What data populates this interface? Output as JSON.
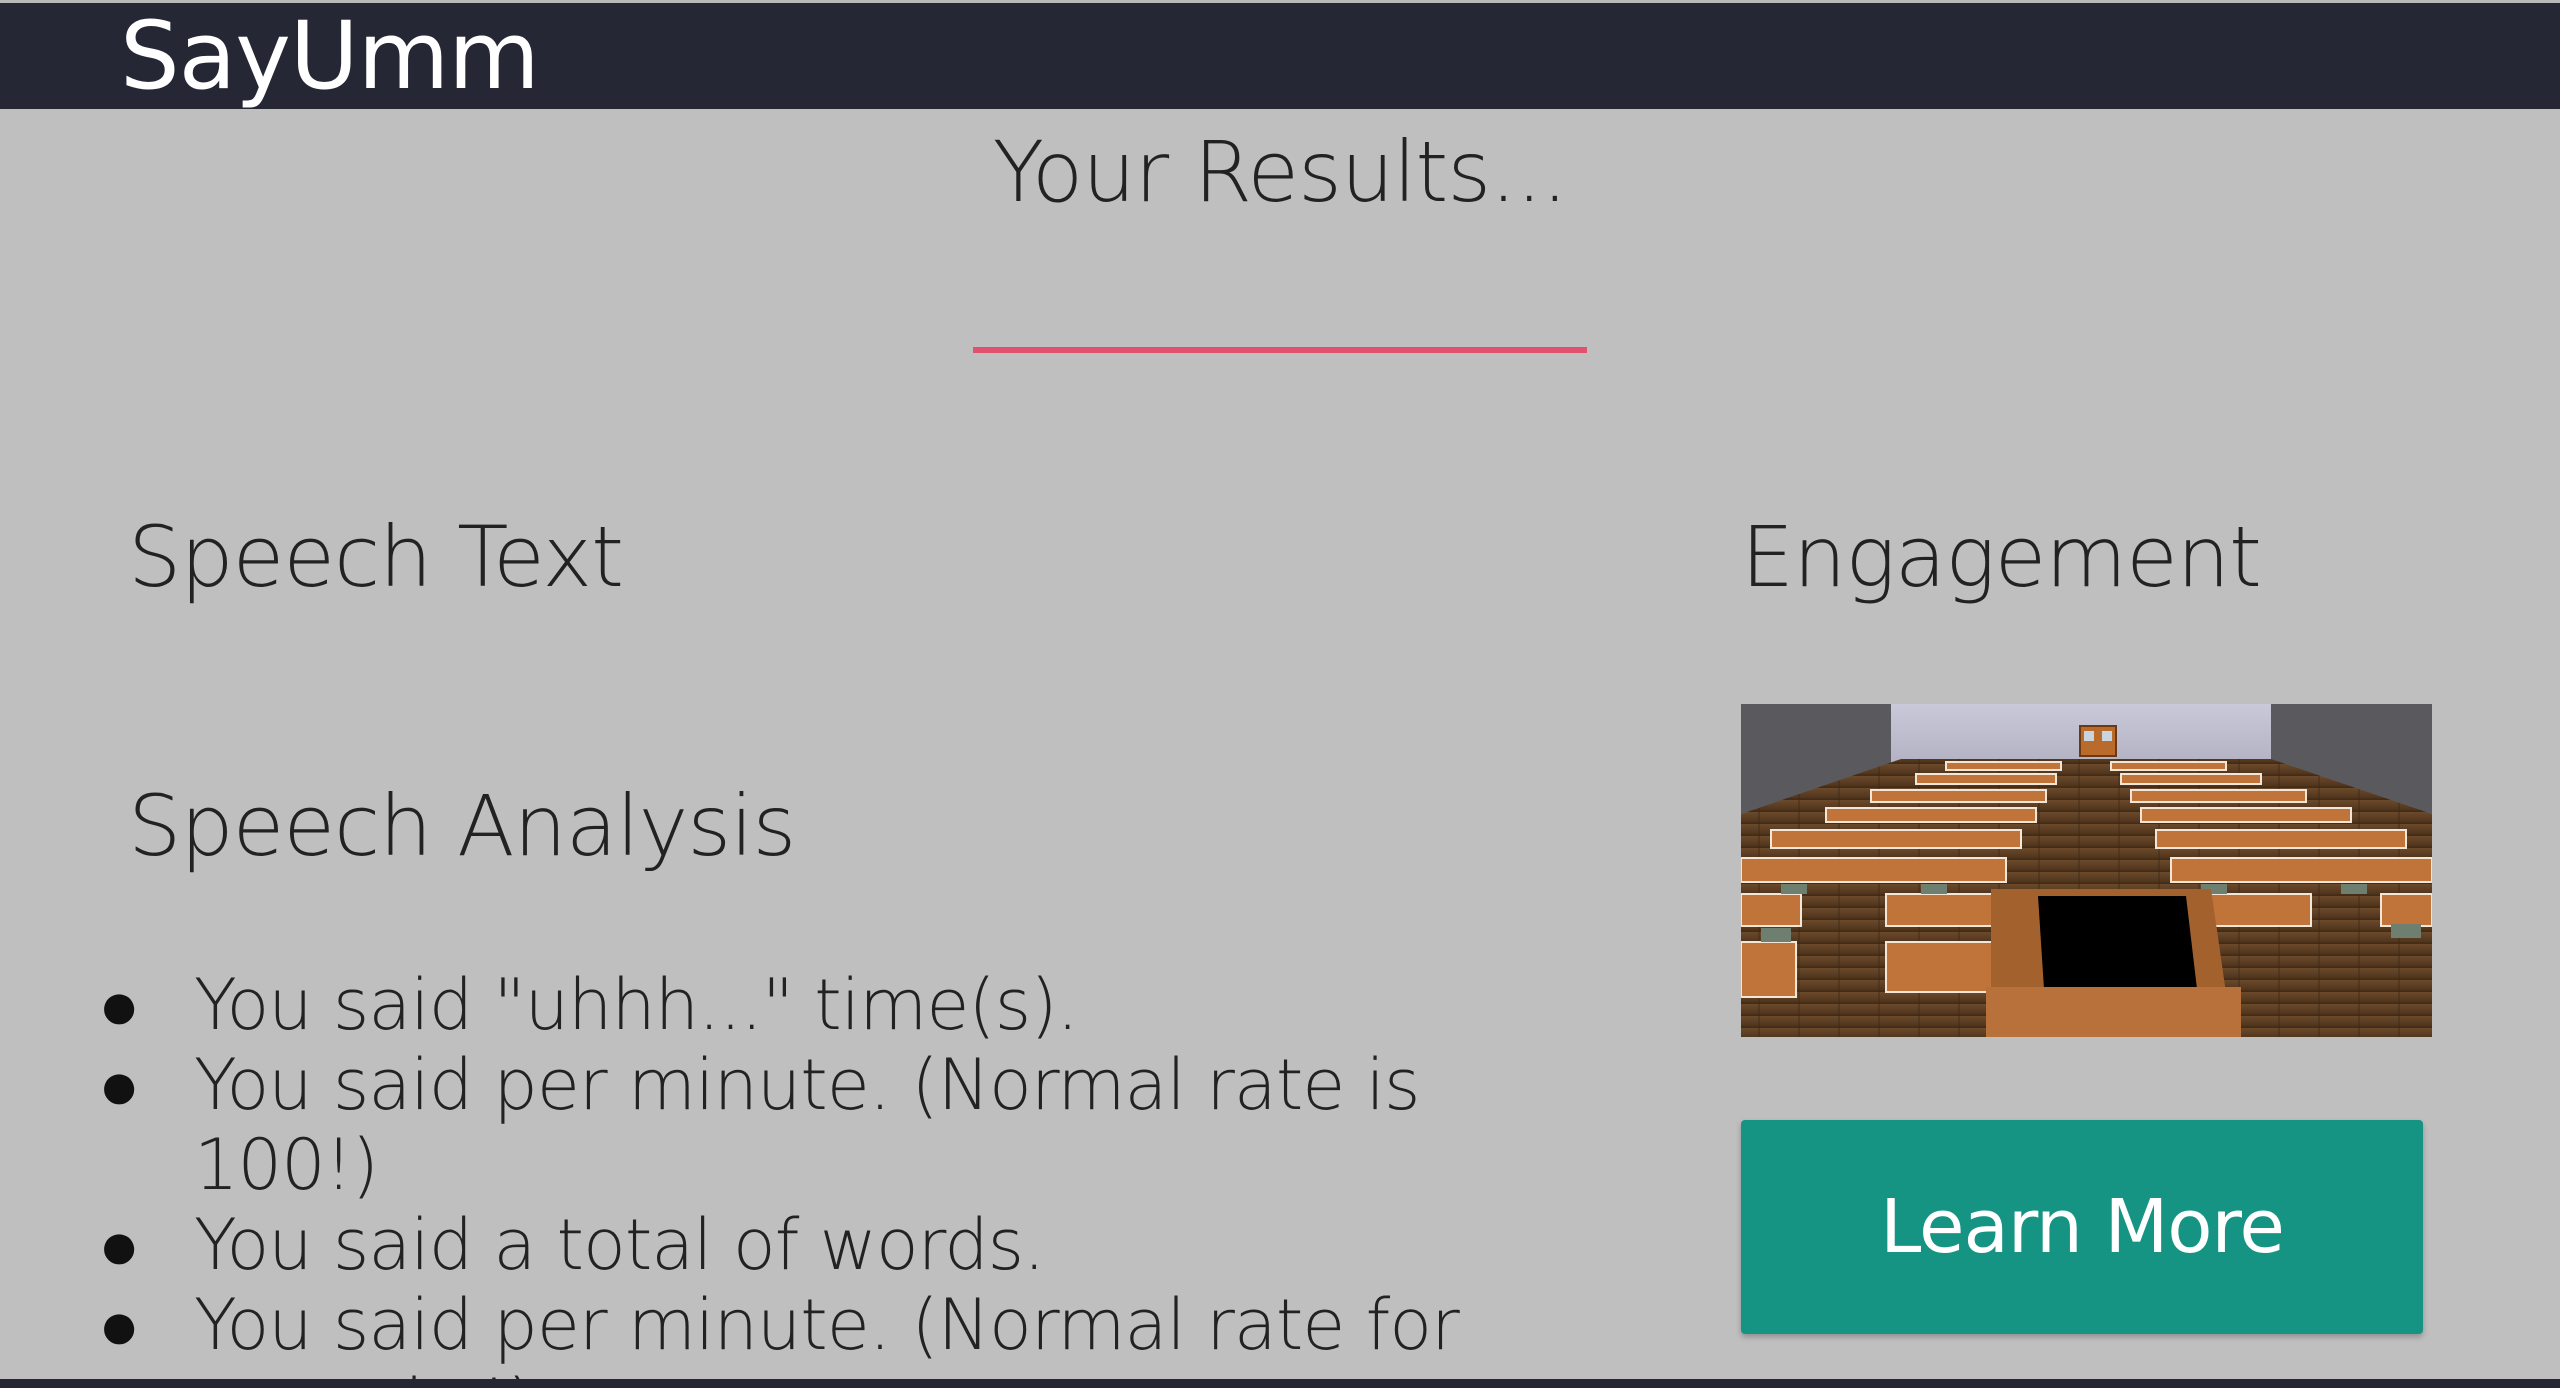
{
  "navbar": {
    "brand": "SayUmm",
    "background_color": "#262735"
  },
  "main": {
    "title": "Your Results...",
    "divider_color": "#e1506c",
    "speech_text_heading": "Speech Text",
    "speech_analysis_heading": "Speech Analysis",
    "analysis_items": [
      {
        "text": "You said \"uhhh...\" time(s)."
      },
      {
        "text": "You said per minute. (Normal rate is 100!)"
      },
      {
        "text": "You said a total of words."
      },
      {
        "text": "You said per minute. (Normal rate for teens is !)"
      }
    ]
  },
  "engagement": {
    "heading": "Engagement",
    "image_icon": "lecture-hall-image",
    "button_label": "Learn More",
    "button_color": "#159484"
  },
  "colors": {
    "page_background": "#bfbfbf",
    "text": "#222222"
  }
}
